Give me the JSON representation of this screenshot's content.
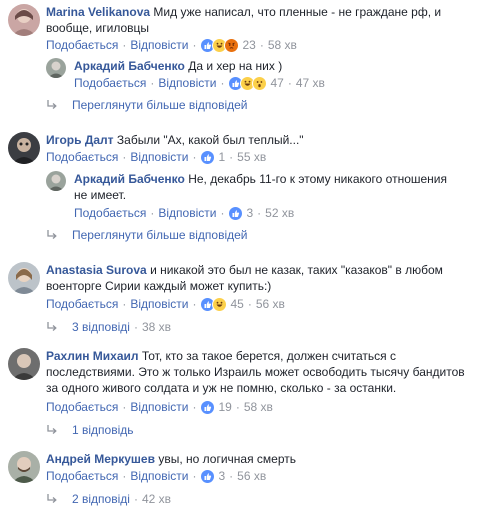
{
  "colors": {
    "link": "#4267b2",
    "author": "#365899",
    "meta": "#90949c"
  },
  "labels": {
    "like": "Подобається",
    "reply": "Відповісти",
    "sep": "·"
  },
  "comments": [
    {
      "author": "Marina Velikanova",
      "text_l1": "Мид уже написал, что пленные - не граждане рф, и",
      "text_l2": "вообще, игиловцы",
      "count": "23",
      "time": "58 хв",
      "reactions": [
        "like",
        "haha",
        "angry"
      ]
    },
    {
      "author": "Аркадий Бабченко",
      "text": "Да и хер на них )",
      "count": "47",
      "time": "47 хв",
      "reactions": [
        "like",
        "haha",
        "wow"
      ]
    },
    {
      "more": "Переглянути більше відповідей"
    },
    {
      "author": "Игорь Далт",
      "text": "Забыли \"Ах, какой был теплый...\"",
      "count": "1",
      "time": "55 хв",
      "reactions": [
        "like"
      ]
    },
    {
      "author": "Аркадий Бабченко",
      "text_l1": "Не, декабрь 11-го к этому никакого отношения",
      "text_l2": "не имеет.",
      "count": "3",
      "time": "52 хв",
      "reactions": [
        "like"
      ]
    },
    {
      "more": "Переглянути більше відповідей"
    },
    {
      "author": "Anastasia Surova",
      "text_l1": "и никакой это был не казак, таких \"казаков\" в любом",
      "text_l2": "военторге Сирии каждый может купить:)",
      "count": "45",
      "time": "56 хв",
      "reactions": [
        "like",
        "haha"
      ]
    },
    {
      "replies": "3 відповіді",
      "time": "38 хв"
    },
    {
      "author": "Рахлин Михаил",
      "text_l1": "Тот, кто за такое берется, должен считаться с",
      "text_l2": "последствиями. Это ж только Израиль может освободить тысячу бандитов",
      "text_l3": "за одного живого солдата и уж не помню, сколько - за останки.",
      "count": "19",
      "time": "58 хв",
      "reactions": [
        "like"
      ]
    },
    {
      "replies": "1 відповідь"
    },
    {
      "author": "Андрей Меркушев",
      "text": "увы, но логичная смерть",
      "count": "3",
      "time": "56 хв",
      "reactions": [
        "like"
      ]
    },
    {
      "replies": "2 відповіді",
      "time": "42 хв"
    }
  ]
}
